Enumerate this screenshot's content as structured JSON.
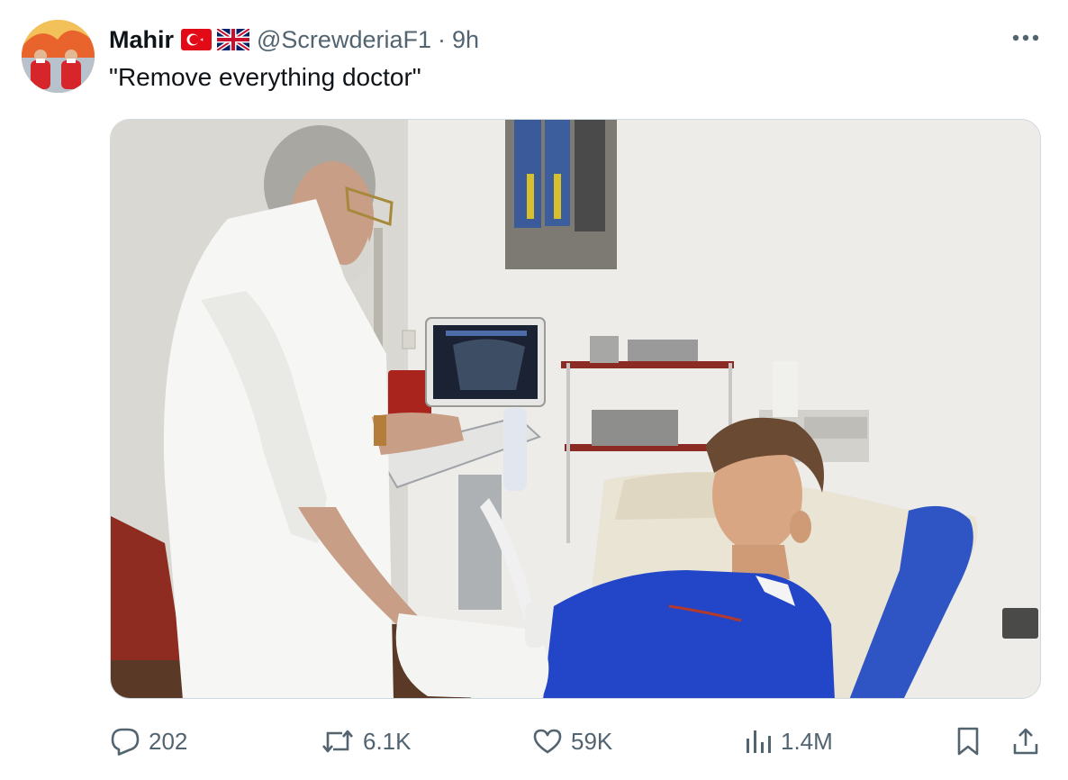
{
  "tweet": {
    "author_name": "Mahir",
    "flags": [
      "turkey-flag-icon",
      "uk-flag-icon"
    ],
    "handle": "@ScrewderiaF1",
    "separator": "·",
    "time": "9h",
    "text": "\"Remove everything doctor\"",
    "more_icon": "more-horizontal-icon"
  },
  "actions": {
    "replies": {
      "icon": "reply-icon",
      "count": "202"
    },
    "reposts": {
      "icon": "repost-icon",
      "count": "6.1K"
    },
    "likes": {
      "icon": "like-icon",
      "count": "59K"
    },
    "views": {
      "icon": "views-icon",
      "count": "1.4M"
    },
    "bookmark": {
      "icon": "bookmark-icon"
    },
    "share": {
      "icon": "share-icon"
    }
  },
  "colors": {
    "text_primary": "#0f1419",
    "text_secondary": "#536471",
    "border": "#cfd9de"
  }
}
